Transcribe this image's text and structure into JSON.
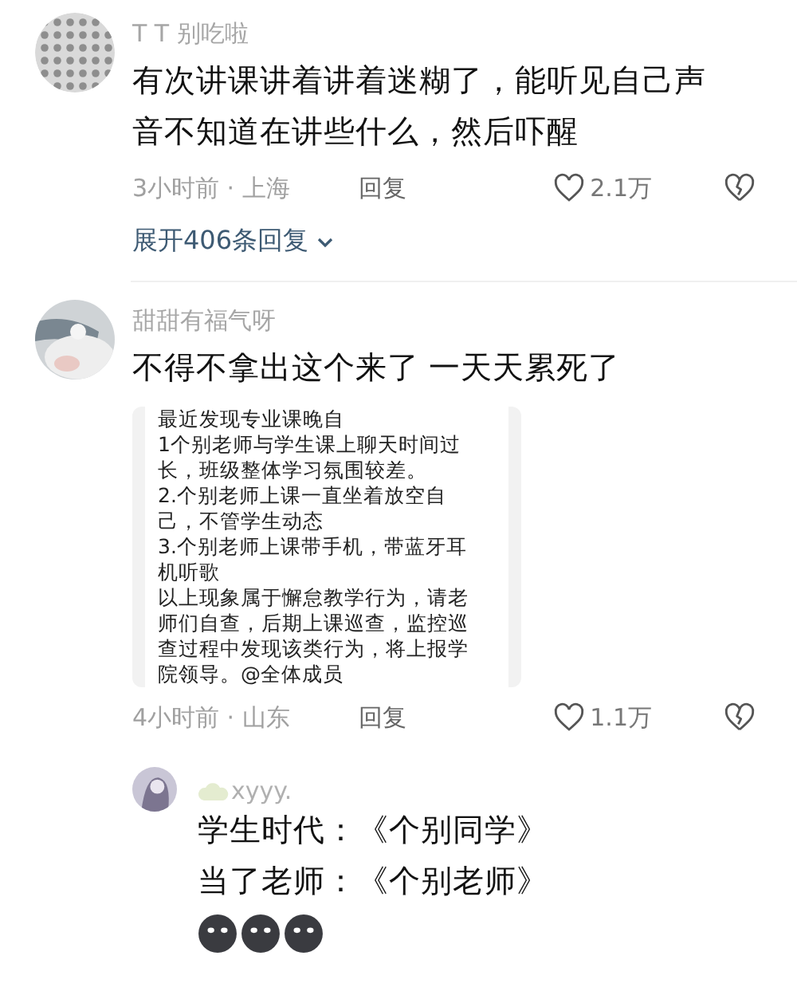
{
  "comments": [
    {
      "user": "T T 别吃啦",
      "text": "有次讲课讲着讲着迷糊了，能听见自己声音不知道在讲些什么，然后吓醒",
      "time_location": "3小时前 · 上海",
      "reply_label": "回复",
      "likes": "2.1万",
      "expand_replies": "展开406条回复"
    },
    {
      "user": "甜甜有福气呀",
      "text": "不得不拿出这个来了 一天天累死了",
      "attachment_lines": [
        "最近发现专业课晚自",
        "1个别老师与学生课上聊天时间过",
        "长，班级整体学习氛围较差。",
        "2.个别老师上课一直坐着放空自",
        "己，不管学生动态",
        "3.个别老师上课带手机，带蓝牙耳",
        "机听歌",
        "以上现象属于懈怠教学行为，请老",
        "师们自查，后期上课巡查，监控巡",
        "查过程中发现该类行为，将上报学",
        "院领导。@全体成员"
      ],
      "time_location": "4小时前 · 山东",
      "reply_label": "回复",
      "likes": "1.1万",
      "replies": [
        {
          "user": "xyyy.",
          "lines": [
            "学生时代：《个别同学》",
            "当了老师：《个别老师》"
          ],
          "emojis": [
            {
              "kind": "blob"
            },
            {
              "kind": "blob"
            },
            {
              "kind": "blob"
            }
          ]
        }
      ]
    }
  ]
}
